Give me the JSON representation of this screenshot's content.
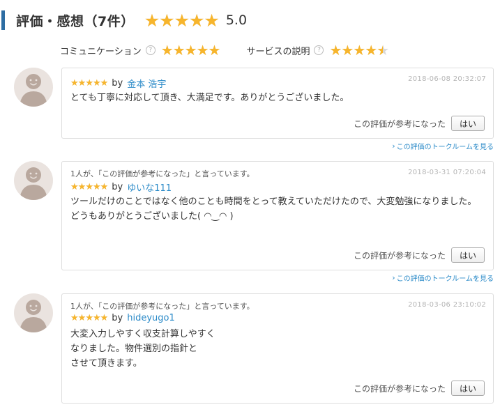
{
  "header": {
    "title": "評価・感想（7件）",
    "score": "5.0",
    "rating": 5.0
  },
  "colors": {
    "star": "#f7b52c",
    "star_empty": "#d8d8d8",
    "link": "#2a8ac8",
    "accent_bar": "#2d6da3"
  },
  "sub_ratings": [
    {
      "label": "コミュニケーション",
      "rating": 5.0
    },
    {
      "label": "サービスの説明",
      "rating": 4.5
    }
  ],
  "helpful_label": "この評価が参考になった",
  "yes_label": "はい",
  "talkroom_link": "この評価のトークルームを見る",
  "reviews": [
    {
      "helpful_note": "",
      "by": "by",
      "name": "金本 浩宇",
      "date": "2018-06-08 20:32:07",
      "body": "とても丁寧に対応して頂き、大満足です。ありがとうございました。",
      "rating": 5
    },
    {
      "helpful_note": "1人が、「この評価が参考になった」と言っています。",
      "by": "by",
      "name": "ゆいな111",
      "date": "2018-03-31 07:20:04",
      "body": "ツールだけのことではなく他のことも時間をとって教えていただけたので、大変勉強になりました。\nどうもありがとうございました( ◠‿◠ )",
      "rating": 5
    },
    {
      "helpful_note": "1人が、「この評価が参考になった」と言っています。",
      "by": "by",
      "name": "hideyugo1",
      "date": "2018-03-06 23:10:02",
      "body": "大変入力しやすく収支計算しやすく\nなりました。物件選別の指針と\nさせて頂きます。",
      "rating": 5
    }
  ]
}
